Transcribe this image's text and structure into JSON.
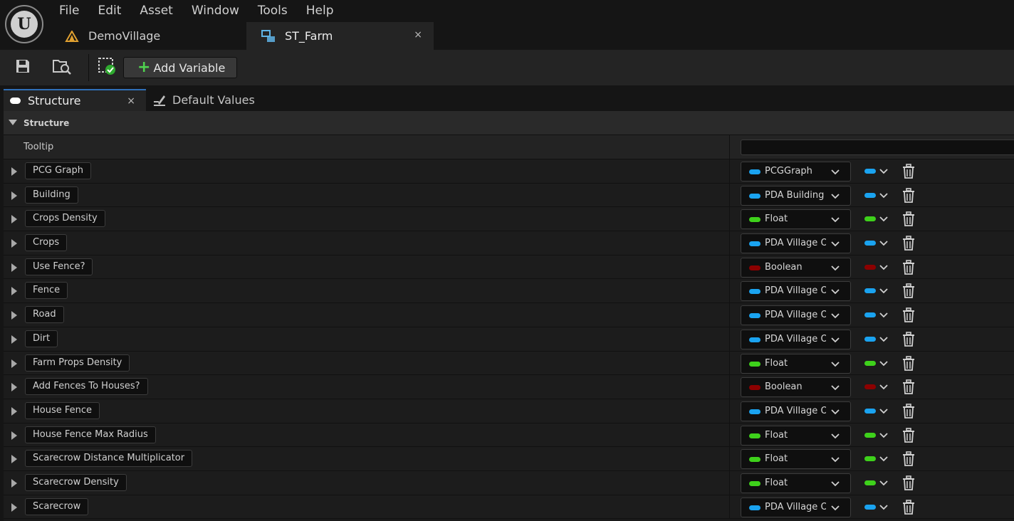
{
  "menubar": [
    "File",
    "Edit",
    "Asset",
    "Window",
    "Tools",
    "Help"
  ],
  "doc_tabs": [
    {
      "label": "DemoVillage",
      "icon": "level-icon",
      "active": false
    },
    {
      "label": "ST_Farm",
      "icon": "struct-asset-icon",
      "active": true,
      "close": "×"
    }
  ],
  "toolbar": {
    "save_icon": "save-icon",
    "browse_icon": "browse-asset-icon",
    "apply_icon": "apply-changes-icon",
    "add_variable_label": "Add Variable"
  },
  "panel_tabs": {
    "structure_label": "Structure",
    "structure_close": "×",
    "defaults_label": "Default Values"
  },
  "details": {
    "section_title": "Structure",
    "tooltip_label": "Tooltip",
    "tooltip_value": ""
  },
  "colors": {
    "object": "#1aa3f0",
    "float": "#3ed11b",
    "boolean": "#8c0000"
  },
  "variables": [
    {
      "name": "PCG Graph",
      "type": "PCGGraph",
      "color": "#1aa3f0"
    },
    {
      "name": "Building",
      "type": "PDA Building",
      "color": "#1aa3f0"
    },
    {
      "name": "Crops Density",
      "type": "Float",
      "color": "#3ed11b"
    },
    {
      "name": "Crops",
      "type": "PDA Village Ob",
      "color": "#1aa3f0"
    },
    {
      "name": "Use Fence?",
      "type": "Boolean",
      "color": "#8c0000"
    },
    {
      "name": "Fence",
      "type": "PDA Village Ob",
      "color": "#1aa3f0"
    },
    {
      "name": "Road",
      "type": "PDA Village Ob",
      "color": "#1aa3f0"
    },
    {
      "name": "Dirt",
      "type": "PDA Village Ob",
      "color": "#1aa3f0"
    },
    {
      "name": "Farm Props Density",
      "type": "Float",
      "color": "#3ed11b"
    },
    {
      "name": "Add Fences To Houses?",
      "type": "Boolean",
      "color": "#8c0000"
    },
    {
      "name": "House Fence",
      "type": "PDA Village Ob",
      "color": "#1aa3f0"
    },
    {
      "name": "House Fence Max Radius",
      "type": "Float",
      "color": "#3ed11b"
    },
    {
      "name": "Scarecrow Distance Multiplicator",
      "type": "Float",
      "color": "#3ed11b"
    },
    {
      "name": "Scarecrow Density",
      "type": "Float",
      "color": "#3ed11b"
    },
    {
      "name": "Scarecrow",
      "type": "PDA Village Ob",
      "color": "#1aa3f0"
    }
  ]
}
